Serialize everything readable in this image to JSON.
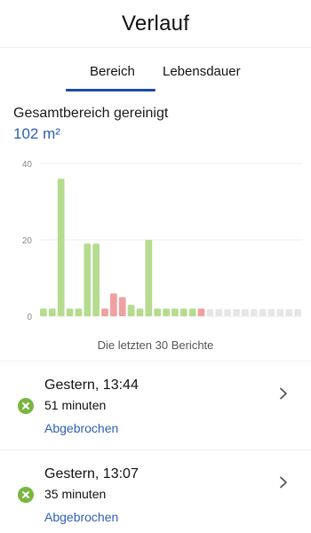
{
  "header": {
    "title": "Verlauf"
  },
  "tabs": [
    {
      "label": "Bereich",
      "active": true
    },
    {
      "label": "Lebensdauer",
      "active": false
    }
  ],
  "summary": {
    "label": "Gesamtbereich gereinigt",
    "value": "102 m²"
  },
  "chart_data": {
    "type": "bar",
    "ylim": [
      0,
      40
    ],
    "yticks": [
      "40",
      "20",
      "0"
    ],
    "grid": true,
    "colors": {
      "completed": "#b5dc8e",
      "aborted": "#f0a0a0",
      "empty": "#e6e6e6"
    },
    "values": [
      2,
      2,
      36,
      2,
      2,
      19,
      19,
      2,
      6,
      5,
      3,
      2,
      20,
      2,
      2,
      2,
      2,
      2,
      2,
      0,
      0,
      0,
      0,
      0,
      0,
      0,
      0,
      0,
      0,
      0
    ],
    "status": [
      "completed",
      "completed",
      "completed",
      "completed",
      "completed",
      "completed",
      "completed",
      "aborted",
      "aborted",
      "aborted",
      "completed",
      "completed",
      "completed",
      "completed",
      "completed",
      "completed",
      "completed",
      "completed",
      "aborted",
      "empty",
      "empty",
      "empty",
      "empty",
      "empty",
      "empty",
      "empty",
      "empty",
      "empty",
      "empty",
      "empty"
    ],
    "caption": "Die letzten 30 Berichte"
  },
  "history": [
    {
      "title": "Gestern, 13:44",
      "duration": "51 minuten",
      "status": "Abgebrochen",
      "icon": "cancel-icon"
    },
    {
      "title": "Gestern, 13:07",
      "duration": "35 minuten",
      "status": "Abgebrochen",
      "icon": "cancel-icon"
    }
  ]
}
